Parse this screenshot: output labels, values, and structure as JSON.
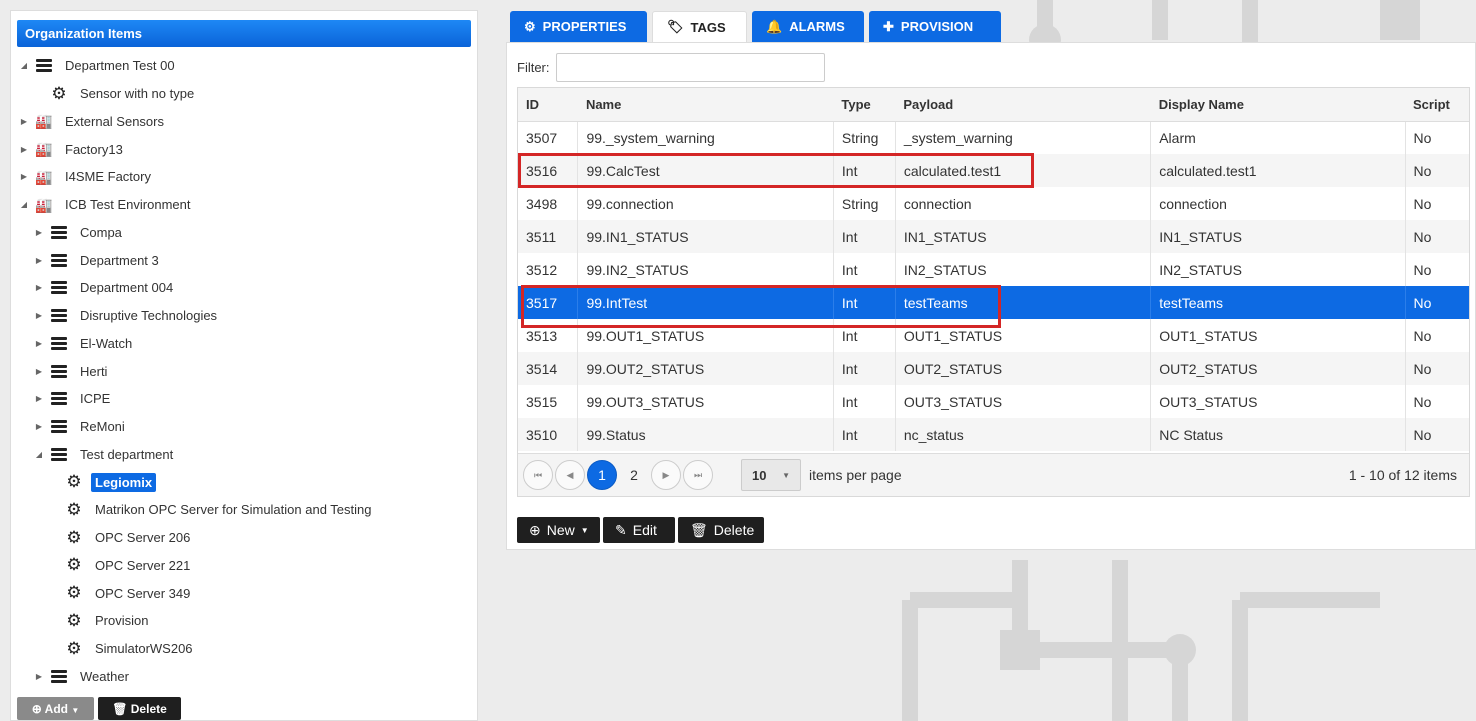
{
  "sidebar": {
    "header": "Organization Items",
    "tree": [
      {
        "label": "Departmen Test 00",
        "icon": "server-icon",
        "expander": "expanded"
      },
      {
        "label": "Sensor with no type",
        "icon": "gear-icon",
        "expander": "none"
      },
      {
        "label": "External Sensors",
        "icon": "building-icon",
        "expander": "collapsed"
      },
      {
        "label": "Factory13",
        "icon": "building-icon",
        "expander": "collapsed"
      },
      {
        "label": "I4SME Factory",
        "icon": "building-icon",
        "expander": "collapsed"
      },
      {
        "label": "ICB Test Environment",
        "icon": "building-icon",
        "expander": "expanded"
      },
      {
        "label": "Compa",
        "icon": "server-icon",
        "expander": "collapsed"
      },
      {
        "label": "Department 3",
        "icon": "server-icon",
        "expander": "collapsed"
      },
      {
        "label": "Department 004",
        "icon": "server-icon",
        "expander": "collapsed"
      },
      {
        "label": "Disruptive Technologies",
        "icon": "server-icon",
        "expander": "collapsed"
      },
      {
        "label": "El-Watch",
        "icon": "server-icon",
        "expander": "collapsed"
      },
      {
        "label": "Herti",
        "icon": "server-icon",
        "expander": "collapsed"
      },
      {
        "label": "ICPE",
        "icon": "server-icon",
        "expander": "collapsed"
      },
      {
        "label": "ReMoni",
        "icon": "server-icon",
        "expander": "collapsed"
      },
      {
        "label": "Test department",
        "icon": "server-icon",
        "expander": "expanded"
      },
      {
        "label": "Legiomix",
        "icon": "gear-icon",
        "expander": "none",
        "selected": true
      },
      {
        "label": "Matrikon OPC Server for Simulation and Testing",
        "icon": "gear-icon",
        "expander": "none"
      },
      {
        "label": "OPC Server 206",
        "icon": "gear-icon",
        "expander": "none"
      },
      {
        "label": "OPC Server 221",
        "icon": "gear-icon",
        "expander": "none"
      },
      {
        "label": "OPC Server 349",
        "icon": "gear-icon",
        "expander": "none"
      },
      {
        "label": "Provision",
        "icon": "gear-icon",
        "expander": "none"
      },
      {
        "label": "SimulatorWS206",
        "icon": "gear-icon",
        "expander": "none"
      },
      {
        "label": "Weather",
        "icon": "server-icon",
        "expander": "collapsed"
      }
    ],
    "add_label": "Add",
    "delete_label": "Delete"
  },
  "tabs": [
    {
      "label": "PROPERTIES",
      "icon": "gear-icon",
      "active": false
    },
    {
      "label": "TAGS",
      "icon": "tag-icon",
      "active": true
    },
    {
      "label": "ALARMS",
      "icon": "bell-icon",
      "active": false
    },
    {
      "label": "PROVISION",
      "icon": "plus-icon",
      "active": false
    }
  ],
  "filter": {
    "label": "Filter:",
    "value": ""
  },
  "grid": {
    "columns": [
      "ID",
      "Name",
      "Type",
      "Payload",
      "Display Name",
      "Script"
    ],
    "rows": [
      {
        "id": "3507",
        "name": "99._system_warning",
        "type": "String",
        "payload": "_system_warning",
        "display_name": "Alarm",
        "script": "No"
      },
      {
        "id": "3516",
        "name": "99.CalcTest",
        "type": "Int",
        "payload": "calculated.test1",
        "display_name": "calculated.test1",
        "script": "No"
      },
      {
        "id": "3498",
        "name": "99.connection",
        "type": "String",
        "payload": "connection",
        "display_name": "connection",
        "script": "No"
      },
      {
        "id": "3511",
        "name": "99.IN1_STATUS",
        "type": "Int",
        "payload": "IN1_STATUS",
        "display_name": "IN1_STATUS",
        "script": "No"
      },
      {
        "id": "3512",
        "name": "99.IN2_STATUS",
        "type": "Int",
        "payload": "IN2_STATUS",
        "display_name": "IN2_STATUS",
        "script": "No"
      },
      {
        "id": "3517",
        "name": "99.IntTest",
        "type": "Int",
        "payload": "testTeams",
        "display_name": "testTeams",
        "script": "No",
        "selected": true
      },
      {
        "id": "3513",
        "name": "99.OUT1_STATUS",
        "type": "Int",
        "payload": "OUT1_STATUS",
        "display_name": "OUT1_STATUS",
        "script": "No"
      },
      {
        "id": "3514",
        "name": "99.OUT2_STATUS",
        "type": "Int",
        "payload": "OUT2_STATUS",
        "display_name": "OUT2_STATUS",
        "script": "No"
      },
      {
        "id": "3515",
        "name": "99.OUT3_STATUS",
        "type": "Int",
        "payload": "OUT3_STATUS",
        "display_name": "OUT3_STATUS",
        "script": "No"
      },
      {
        "id": "3510",
        "name": "99.Status",
        "type": "Int",
        "payload": "nc_status",
        "display_name": "NC Status",
        "script": "No"
      }
    ],
    "highlighted_row_ids": [
      "3516",
      "3517"
    ]
  },
  "pager": {
    "pages": [
      "1",
      "2"
    ],
    "current_page": "1",
    "page_size": "10",
    "items_per_page_label": "items per page",
    "range_text": "1 - 10 of 12 items"
  },
  "actions": {
    "new_label": "New",
    "edit_label": "Edit",
    "delete_label": "Delete"
  },
  "colors": {
    "accent": "#0d6ae3",
    "highlight_box": "#d42626",
    "dark_button": "#1f1f1f",
    "background": "#ececec"
  }
}
